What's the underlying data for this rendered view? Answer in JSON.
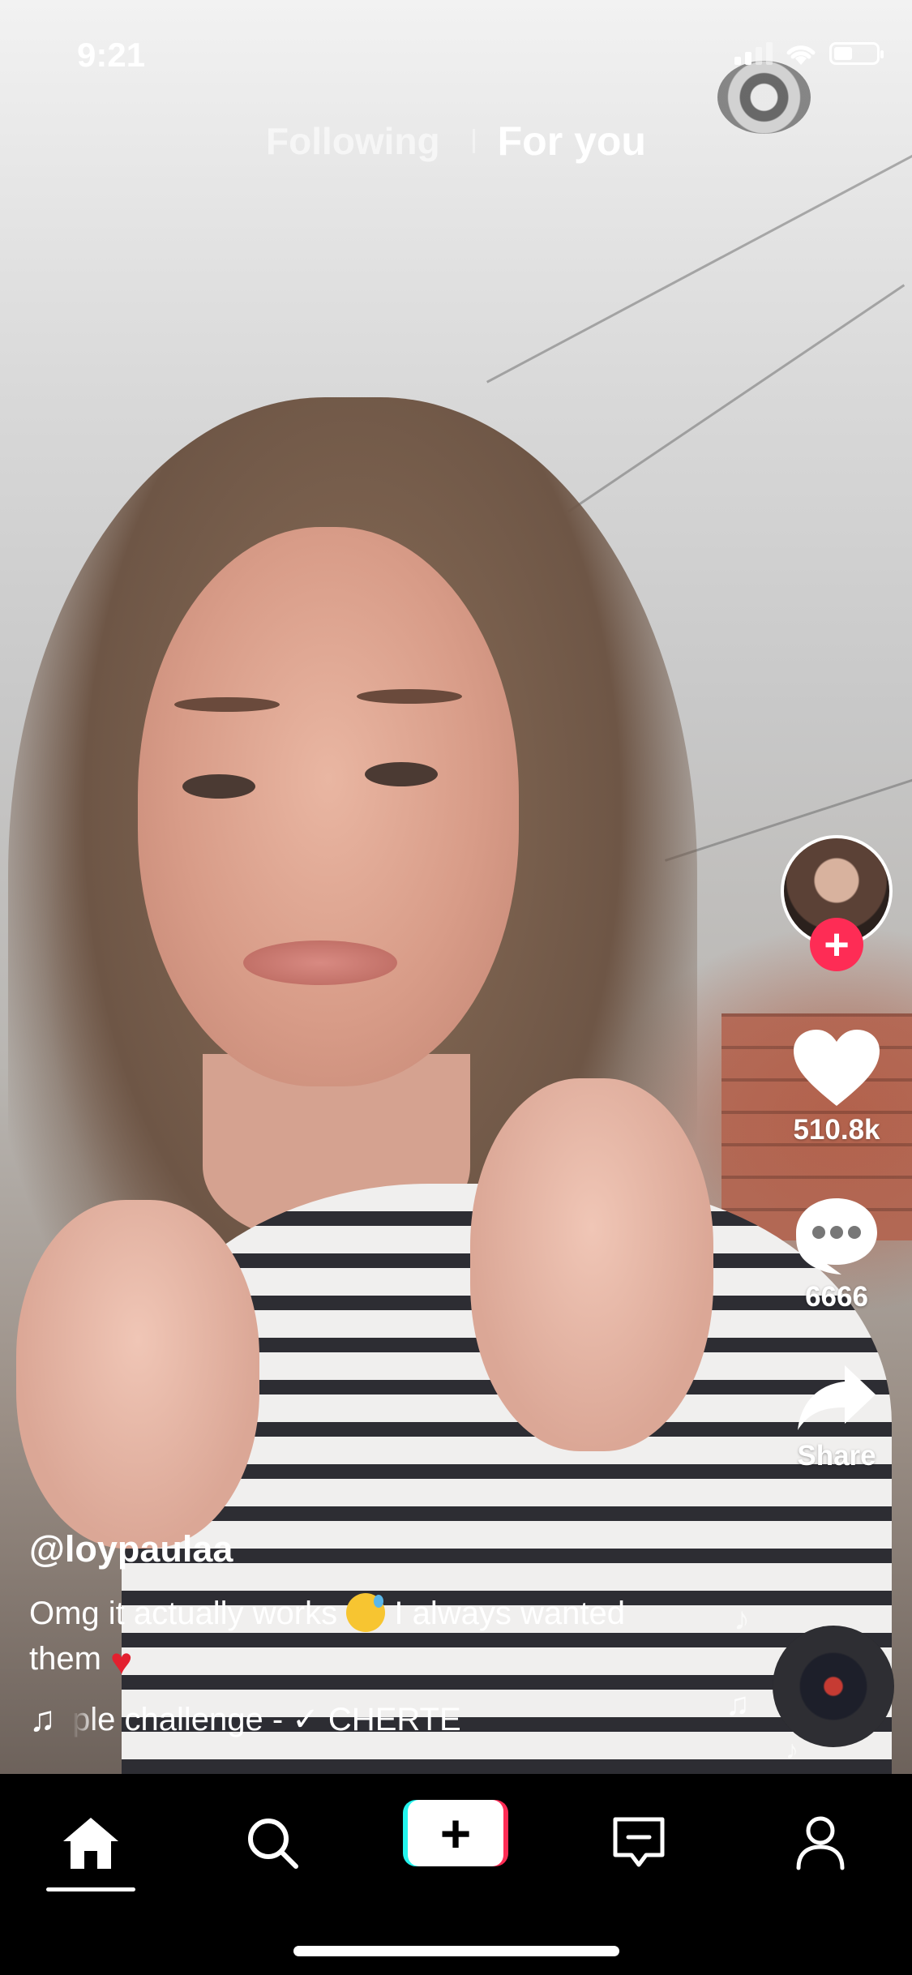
{
  "status_bar": {
    "time": "9:21"
  },
  "top_tabs": {
    "following": "Following",
    "for_you": "For you"
  },
  "rail": {
    "follow_symbol": "+",
    "like_count": "510.8k",
    "comment_count": "6666",
    "share_label": "Share"
  },
  "post": {
    "username": "@loypaulaa",
    "caption_text_1": "Omg it actually works",
    "caption_text_2": "I always wanted them",
    "music_text": "ple challenge - ✓ CHERTE"
  },
  "bottom_nav": {
    "create_symbol": "+"
  },
  "colors": {
    "accent": "#fe2c55",
    "cyan": "#25f4ee"
  },
  "icons": [
    "signal-icon",
    "wifi-icon",
    "battery-icon",
    "heart-icon",
    "comment-icon",
    "share-icon",
    "music-note-icon",
    "home-icon",
    "search-icon",
    "inbox-icon",
    "profile-icon"
  ]
}
